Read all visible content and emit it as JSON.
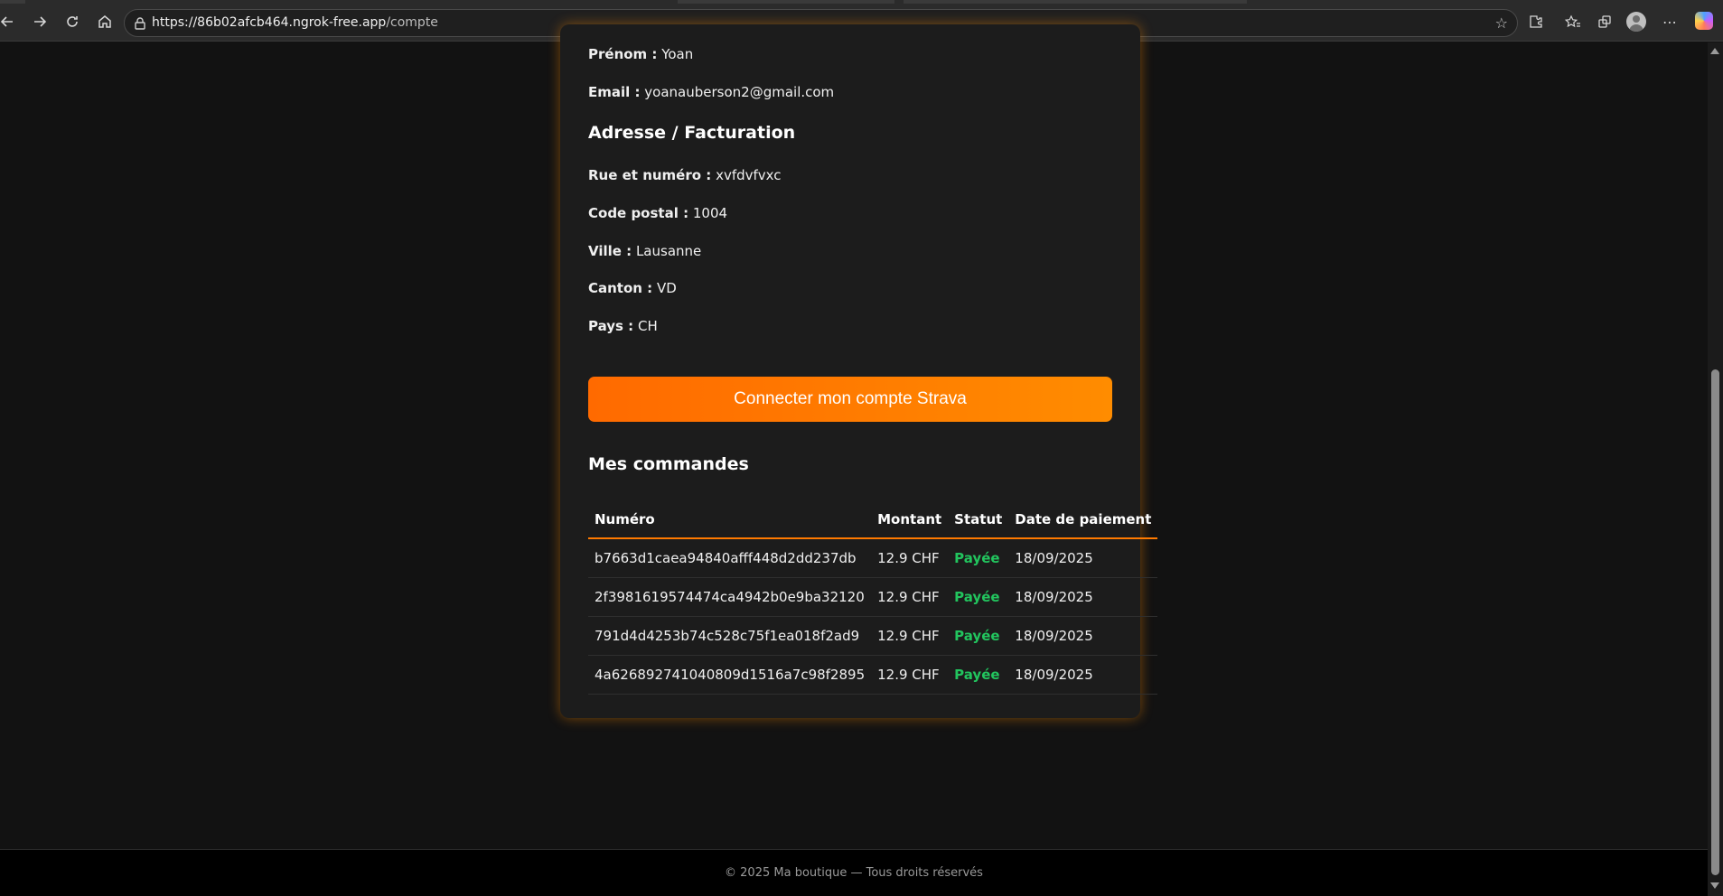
{
  "browser": {
    "url_host": "https://86b02afcb464.ngrok-free.app",
    "url_path": "/compte",
    "icons": [
      "back-icon",
      "forward-icon",
      "reload-icon",
      "home-icon",
      "lock-icon",
      "star-icon",
      "extensions-icon",
      "favorites-icon",
      "collections-icon",
      "profile-icon",
      "more-icon",
      "copilot-icon"
    ]
  },
  "profile": {
    "prenom_label": "Prénom :",
    "prenom_value": "Yoan",
    "email_label": "Email :",
    "email_value": "yoanauberson2@gmail.com"
  },
  "address": {
    "title": "Adresse / Facturation",
    "street_label": "Rue et numéro :",
    "street_value": "xvfdvfvxc",
    "postal_label": "Code postal :",
    "postal_value": "1004",
    "city_label": "Ville :",
    "city_value": "Lausanne",
    "canton_label": "Canton :",
    "canton_value": "VD",
    "country_label": "Pays :",
    "country_value": "CH"
  },
  "strava_button": "Connecter mon compte Strava",
  "orders": {
    "title": "Mes commandes",
    "headers": [
      "Numéro",
      "Montant",
      "Statut",
      "Date de paiement"
    ],
    "rows": [
      [
        "b7663d1caea94840afff448d2dd237db",
        "12.9 CHF",
        "Payée",
        "18/09/2025"
      ],
      [
        "2f3981619574474ca4942b0e9ba32120",
        "12.9 CHF",
        "Payée",
        "18/09/2025"
      ],
      [
        "791d4d4253b74c528c75f1ea018f2ad9",
        "12.9 CHF",
        "Payée",
        "18/09/2025"
      ],
      [
        "4a626892741040809d1516a7c98f2895",
        "12.9 CHF",
        "Payée",
        "18/09/2025"
      ]
    ]
  },
  "footer": "© 2025 Ma boutique — Tous droits réservés",
  "colors": {
    "accent": "#ff7a00",
    "paid": "#22c55e",
    "card_bg": "#1c1c1c",
    "page_bg": "#121212"
  }
}
